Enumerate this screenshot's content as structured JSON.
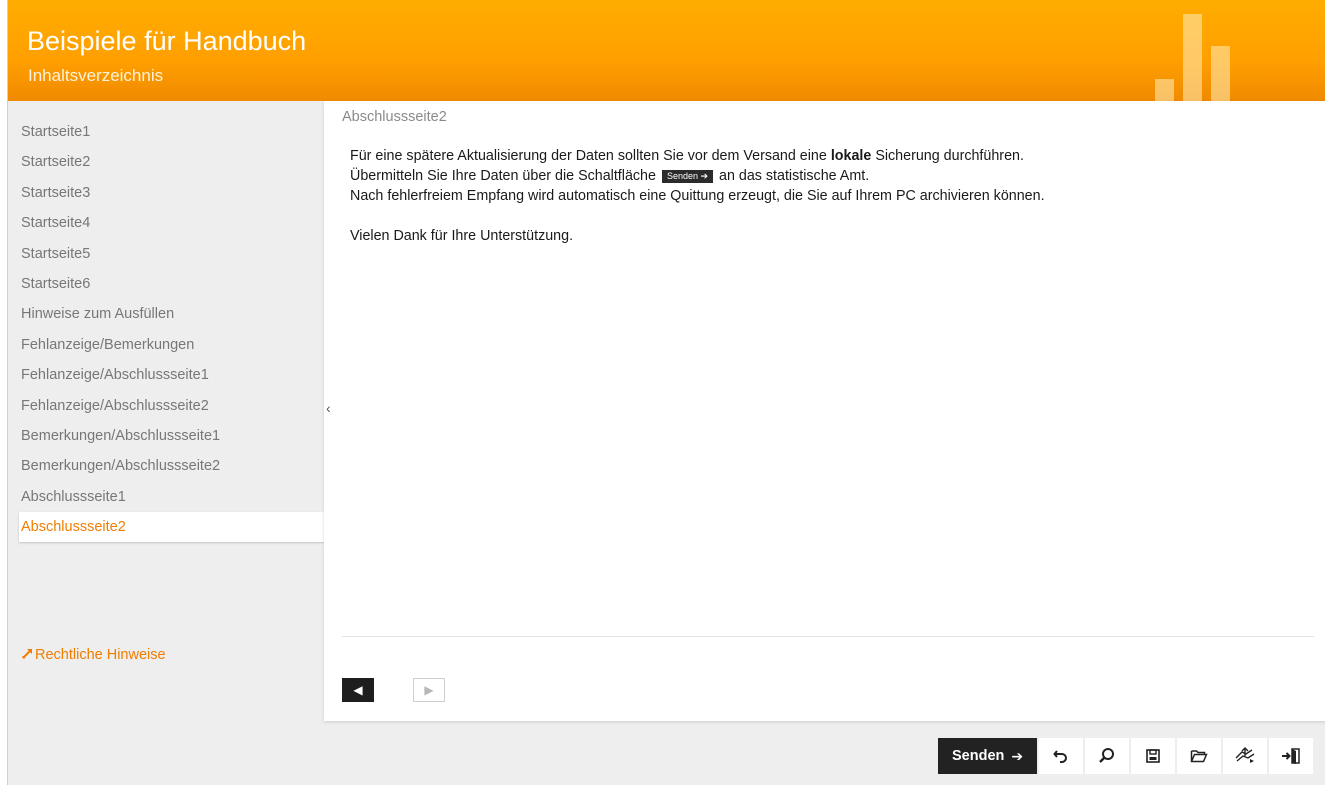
{
  "header": {
    "title": "Beispiele für Handbuch",
    "subtitle": "Inhaltsverzeichnis"
  },
  "sidebar": {
    "items": [
      {
        "label": "Startseite1"
      },
      {
        "label": "Startseite2"
      },
      {
        "label": "Startseite3"
      },
      {
        "label": "Startseite4"
      },
      {
        "label": "Startseite5"
      },
      {
        "label": "Startseite6"
      },
      {
        "label": "Hinweise zum Ausfüllen"
      },
      {
        "label": "Fehlanzeige/Bemerkungen"
      },
      {
        "label": "Fehlanzeige/Abschlussseite1"
      },
      {
        "label": "Fehlanzeige/Abschlussseite2"
      },
      {
        "label": "Bemerkungen/Abschlussseite1"
      },
      {
        "label": "Bemerkungen/Abschlussseite2"
      },
      {
        "label": "Abschlussseite1"
      },
      {
        "label": "Abschlussseite2",
        "active": true
      }
    ],
    "legal_link": "Rechtliche Hinweise",
    "collapse_glyph": "‹"
  },
  "content": {
    "page_title": "Abschlussseite2",
    "line1_pre": "Für eine spätere Aktualisierung der Daten sollten Sie vor dem Versand eine ",
    "line1_bold": "lokale",
    "line1_post": " Sicherung durchführen.",
    "line2_pre": "Übermitteln Sie Ihre Daten über die Schaltfläche ",
    "line2_button": "Senden ➔",
    "line2_post": " an das statistische Amt.",
    "line3": "Nach fehlerfreiem Empfang wird automatisch eine Quittung erzeugt, die Sie auf Ihrem PC archivieren können.",
    "line4": "Vielen Dank für Ihre Unterstützung."
  },
  "pager": {
    "prev_glyph": "◀",
    "next_glyph": "▶"
  },
  "toolbar": {
    "send_label": "Senden",
    "send_arrow": "➔",
    "icons": [
      "undo-icon",
      "search-icon",
      "save-icon",
      "open-folder-icon",
      "export-icon",
      "exit-icon"
    ]
  },
  "colors": {
    "header_orange": "#ff9f00",
    "accent_orange": "#f07d00",
    "dark_button": "#222222"
  }
}
